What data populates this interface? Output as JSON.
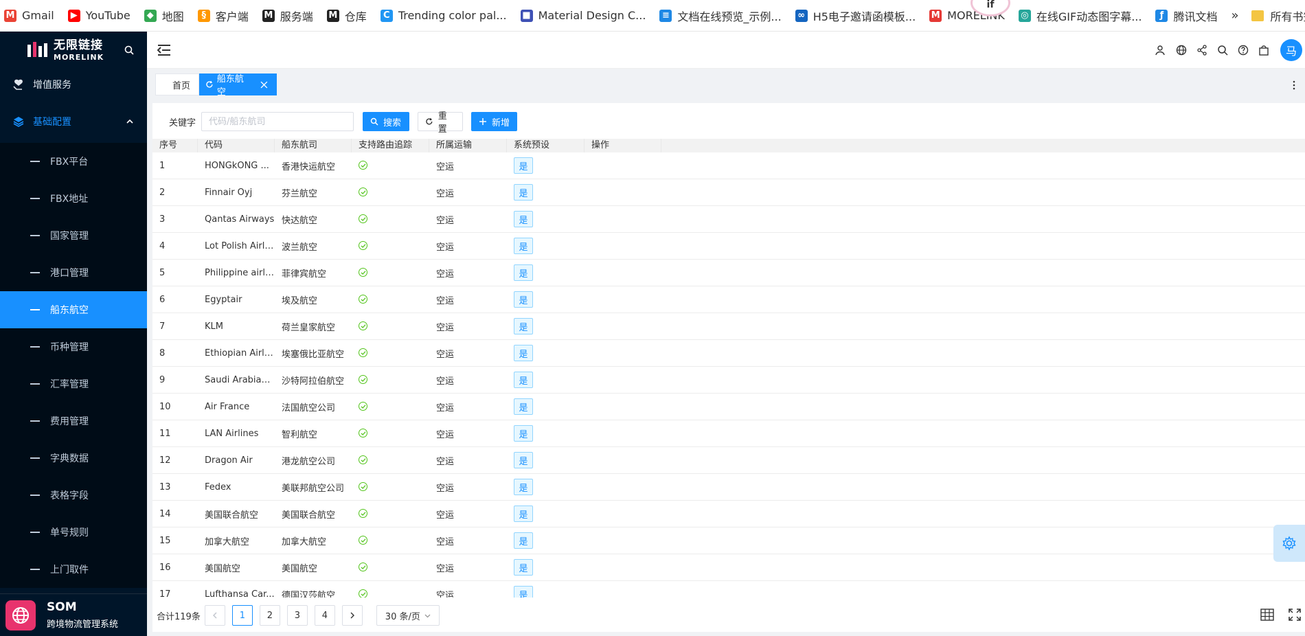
{
  "bookmarks": [
    {
      "label": "Gmail",
      "color": "#ea4335",
      "glyph": "M"
    },
    {
      "label": "YouTube",
      "color": "#ff0000",
      "glyph": "▶"
    },
    {
      "label": "地图",
      "color": "#34a853",
      "glyph": "◆"
    },
    {
      "label": "客户端",
      "color": "#ff9800",
      "glyph": "§"
    },
    {
      "label": "服务端",
      "color": "#222222",
      "glyph": "M"
    },
    {
      "label": "仓库",
      "color": "#222222",
      "glyph": "M"
    },
    {
      "label": "Trending color pal...",
      "color": "#2196f3",
      "glyph": "C"
    },
    {
      "label": "Material Design C...",
      "color": "#3f51b5",
      "glyph": "■"
    },
    {
      "label": "文档在线预览_示例...",
      "color": "#1e88e5",
      "glyph": "≡"
    },
    {
      "label": "H5电子邀请函模板...",
      "color": "#1565c0",
      "glyph": "∞"
    },
    {
      "label": "MORELINK",
      "color": "#e53935",
      "glyph": "M"
    },
    {
      "label": "在线GIF动态图字幕...",
      "color": "#26a69a",
      "glyph": "◎"
    },
    {
      "label": "腾讯文档",
      "color": "#1e88e5",
      "glyph": "ƒ"
    }
  ],
  "bookmarks_more": "»",
  "bookmarks_all": "所有书签",
  "sidebar": {
    "logo_cn": "无限链接",
    "logo_en": "MORELINK",
    "menu_top": "增值服务",
    "group": "基础配置",
    "items": [
      "FBX平台",
      "FBX地址",
      "国家管理",
      "港口管理",
      "船东航空",
      "币种管理",
      "汇率管理",
      "费用管理",
      "字典数据",
      "表格字段",
      "单号规则",
      "上门取件"
    ],
    "active_index": 4,
    "system_name": "SOM",
    "system_desc": "跨境物流管理系统"
  },
  "header": {
    "avatar": "马"
  },
  "tabs": {
    "home": "首页",
    "active": "船东航空"
  },
  "search": {
    "label": "关键字",
    "placeholder": "代码/船东航司",
    "search_btn": "搜索",
    "reset_btn": "重置",
    "add_btn": "新增"
  },
  "table": {
    "columns": [
      "序号",
      "代码",
      "船东航司",
      "支持路由追踪",
      "所属运输",
      "系统预设",
      "操作"
    ],
    "rows": [
      [
        "1",
        "HONGkONG ...",
        "香港快运航空",
        "空运",
        "是"
      ],
      [
        "2",
        "Finnair Oyj",
        "芬兰航空",
        "空运",
        "是"
      ],
      [
        "3",
        "Qantas Airways",
        "快达航空",
        "空运",
        "是"
      ],
      [
        "4",
        "Lot Polish Airli...",
        "波兰航空",
        "空运",
        "是"
      ],
      [
        "5",
        "Philippine airli...",
        "菲律宾航空",
        "空运",
        "是"
      ],
      [
        "6",
        "Egyptair",
        "埃及航空",
        "空运",
        "是"
      ],
      [
        "7",
        "KLM",
        "荷兰皇家航空",
        "空运",
        "是"
      ],
      [
        "8",
        "Ethiopian Airli...",
        "埃塞俄比亚航空",
        "空运",
        "是"
      ],
      [
        "9",
        "Saudi Arabian...",
        "沙特阿拉伯航空",
        "空运",
        "是"
      ],
      [
        "10",
        "Air France",
        "法国航空公司",
        "空运",
        "是"
      ],
      [
        "11",
        "LAN Airlines",
        "智利航空",
        "空运",
        "是"
      ],
      [
        "12",
        "Dragon Air",
        "港龙航空公司",
        "空运",
        "是"
      ],
      [
        "13",
        "Fedex",
        "美联邦航空公司",
        "空运",
        "是"
      ],
      [
        "14",
        "美国联合航空",
        "美国联合航空",
        "空运",
        "是"
      ],
      [
        "15",
        "加拿大航空",
        "加拿大航空",
        "空运",
        "是"
      ],
      [
        "16",
        "美国航空",
        "美国航空",
        "空运",
        "是"
      ],
      [
        "17",
        "Lufthansa Car...",
        "德国汉莎航空",
        "空运",
        "是"
      ]
    ]
  },
  "pager": {
    "total": "合计119条",
    "pages": [
      "1",
      "2",
      "3",
      "4"
    ],
    "current": "1",
    "page_size": "30 条/页"
  },
  "colors": {
    "primary": "#1890ff",
    "sidebar_bg": "#001529",
    "success": "#52c41a"
  }
}
